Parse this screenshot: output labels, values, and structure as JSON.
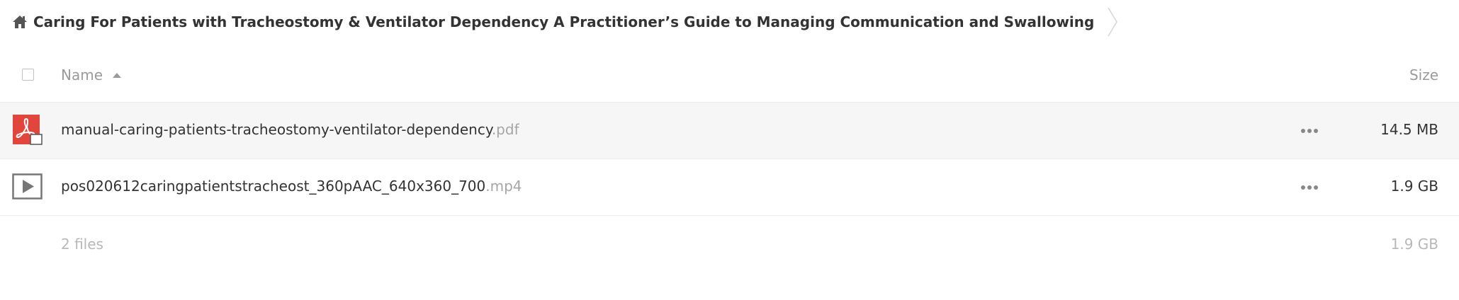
{
  "breadcrumb": {
    "home_icon": "home-icon",
    "title": "Caring For Patients with Tracheostomy & Ventilator Dependency A Practitioner’s Guide to Managing Communication and Swallowing",
    "separator_icon": "chevron-right-icon"
  },
  "header": {
    "name_label": "Name",
    "sort_icon": "sort-ascending-icon",
    "size_label": "Size"
  },
  "files": [
    {
      "icon": "pdf-file-icon",
      "name": "manual-caring-patients-tracheostomy-ventilator-dependency",
      "ext": ".pdf",
      "size": "14.5 MB",
      "selected": true
    },
    {
      "icon": "video-file-icon",
      "name": "pos020612caringpatientstracheost_360pAAC_640x360_700",
      "ext": ".mp4",
      "size": "1.9 GB",
      "selected": false
    }
  ],
  "summary": {
    "count": "2 files",
    "total_size": "1.9 GB"
  },
  "colors": {
    "pdf_red": "#e0463c",
    "muted_text": "#9a9a9a",
    "row_selected": "#f6f6f6"
  }
}
